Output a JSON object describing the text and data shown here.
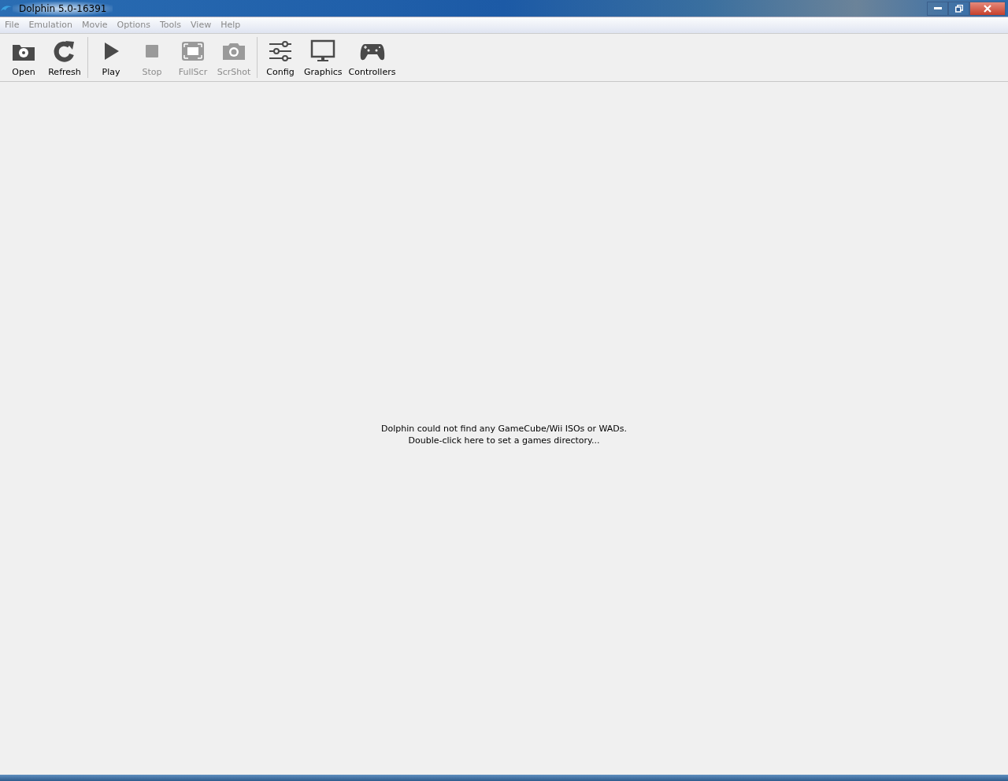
{
  "window": {
    "title": "Dolphin 5.0-16391"
  },
  "menu": [
    "File",
    "Emulation",
    "Movie",
    "Options",
    "Tools",
    "View",
    "Help"
  ],
  "toolbar": {
    "groups": [
      [
        {
          "label": "Open",
          "kind": "open",
          "disabled": false
        },
        {
          "label": "Refresh",
          "kind": "refresh",
          "disabled": false
        }
      ],
      [
        {
          "label": "Play",
          "kind": "play",
          "disabled": false
        },
        {
          "label": "Stop",
          "kind": "stop",
          "disabled": true
        },
        {
          "label": "FullScr",
          "kind": "fullscreen",
          "disabled": true
        },
        {
          "label": "ScrShot",
          "kind": "screenshot",
          "disabled": true
        }
      ],
      [
        {
          "label": "Config",
          "kind": "config",
          "disabled": false
        },
        {
          "label": "Graphics",
          "kind": "graphics",
          "disabled": false
        },
        {
          "label": "Controllers",
          "kind": "controllers",
          "disabled": false
        }
      ]
    ]
  },
  "game_list": {
    "message": [
      "Dolphin could not find any GameCube/Wii ISOs or WADs.",
      "Double-click here to set a games directory..."
    ]
  }
}
